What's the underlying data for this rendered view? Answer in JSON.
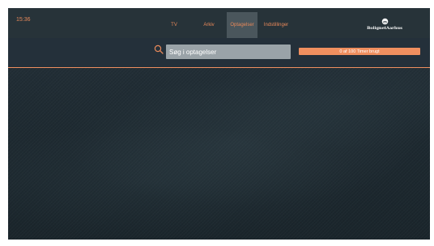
{
  "status": {
    "time": "15:36"
  },
  "nav": {
    "items": [
      {
        "label": "TV",
        "active": false
      },
      {
        "label": "Arkiv",
        "active": false
      },
      {
        "label": "Optagelser",
        "active": true
      },
      {
        "label": "Indstillinger",
        "active": false
      }
    ]
  },
  "logo": {
    "text": "BolignetAarhus"
  },
  "search": {
    "placeholder": "Søg i optagelser",
    "value": ""
  },
  "usage": {
    "label": "0 af 100 Timer brugt",
    "used_hours": 0,
    "total_hours": 100
  },
  "colors": {
    "accent": "#f08f5f",
    "background": "#1f2b32",
    "active_tab": "#4a565c"
  }
}
